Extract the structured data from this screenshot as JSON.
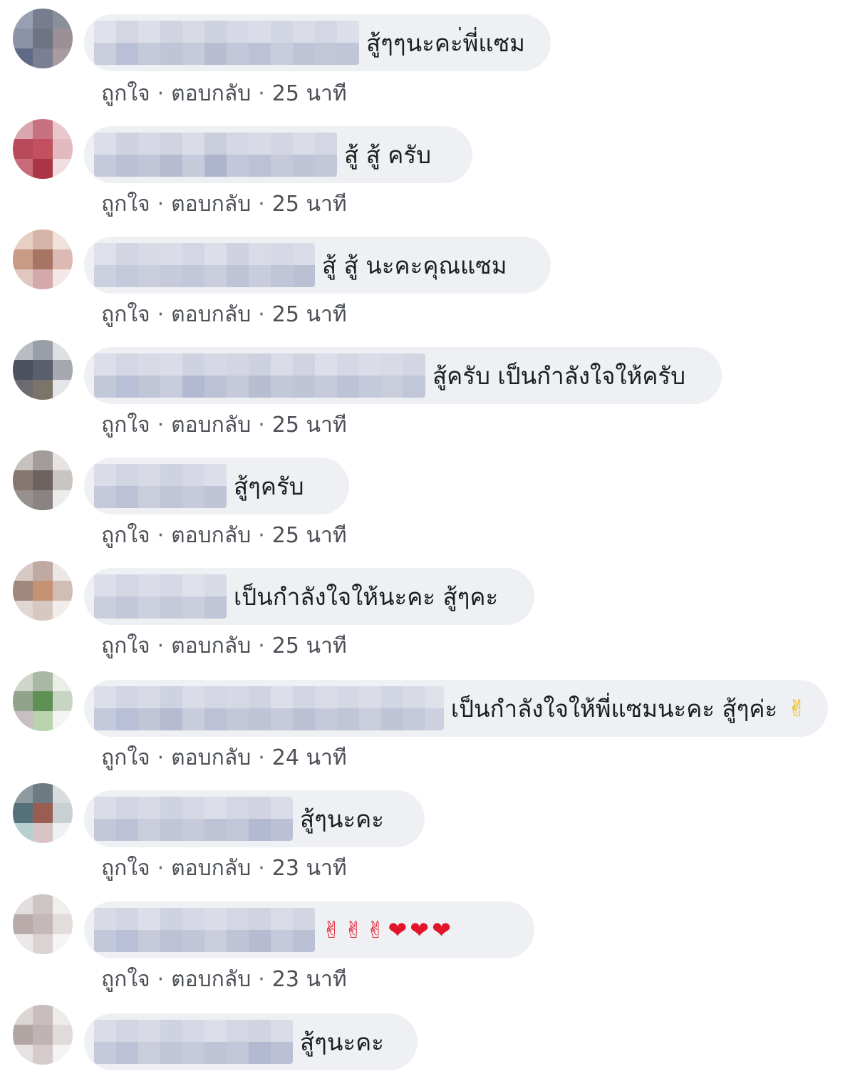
{
  "actions": {
    "like": "ถูกใจ",
    "reply": "ตอบกลับ",
    "separator": "·"
  },
  "colors": {
    "bubble": "#eef0f3",
    "text": "#1c1e21",
    "meta": "#4b4f56"
  },
  "comments": [
    {
      "text": "สู้ๆๆนะคะ่พี่แซม",
      "time": "25 นาที"
    },
    {
      "text": "สู้ สู้ ครับ",
      "time": "25 นาที"
    },
    {
      "text": "สู้ สู้ นะคะคุณแซม",
      "time": "25 นาที"
    },
    {
      "text": "สู้ครับ เป็นกำลังใจให้ครับ",
      "time": "25 นาที"
    },
    {
      "text": "สู้ๆครับ",
      "time": "25 นาที"
    },
    {
      "text": "เป็นกำลังใจให้นะคะ สู้ๆคะ",
      "time": "25 นาที"
    },
    {
      "text": "เป็นกำลังใจให้พี่แซมนะคะ สู้ๆค่ะ",
      "emoji": "✌",
      "time": "24 นาที"
    },
    {
      "text": "สู้ๆนะคะ",
      "time": "23 นาที"
    },
    {
      "text": "",
      "emoji": "✌✌✌❤❤❤",
      "time": "23 นาที"
    },
    {
      "text": "สู้ๆนะคะ",
      "time": ""
    }
  ]
}
